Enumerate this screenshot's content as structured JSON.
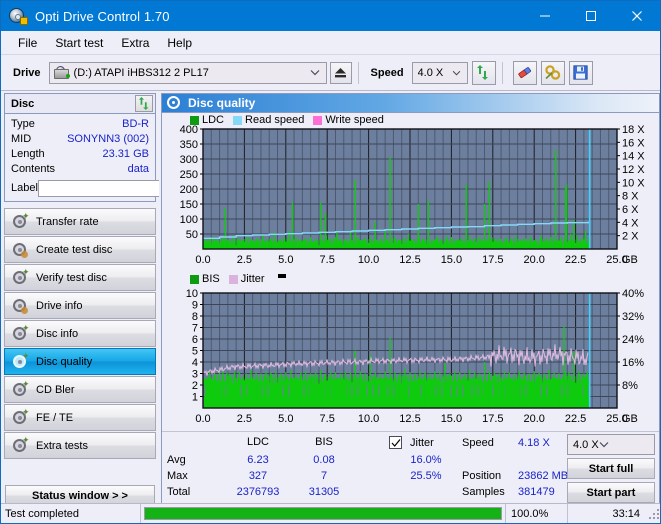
{
  "window": {
    "title": "Opti Drive Control 1.70",
    "icon": "app-disc-icon",
    "minimize": "minimize-icon",
    "maximize": "maximize-icon",
    "close": "close-icon"
  },
  "menubar": {
    "items": [
      {
        "label": "File"
      },
      {
        "label": "Start test"
      },
      {
        "label": "Extra"
      },
      {
        "label": "Help"
      }
    ]
  },
  "toolbar": {
    "drive_label": "Drive",
    "drive_value": "(D:)  ATAPI iHBS312  2 PL17",
    "eject_icon": "eject-icon",
    "speed_label": "Speed",
    "speed_value": "4.0 X",
    "refresh_icon": "refresh-icon",
    "erase_icon": "eraser-icon",
    "tools_icon": "tools-icon",
    "save_icon": "save-icon"
  },
  "sidebar": {
    "disc_panel": {
      "title": "Disc",
      "refresh_icon": "refresh-icon",
      "rows": [
        {
          "key": "Type",
          "value": "BD-R"
        },
        {
          "key": "MID",
          "value": "SONYNN3 (002)"
        },
        {
          "key": "Length",
          "value": "23.31 GB"
        },
        {
          "key": "Contents",
          "value": "data"
        }
      ],
      "label_key": "Label",
      "label_value": "",
      "label_placeholder": "",
      "disc_button_icon": "cd-icon"
    },
    "nav": [
      {
        "label": "Transfer rate",
        "active": false
      },
      {
        "label": "Create test disc",
        "active": false
      },
      {
        "label": "Verify test disc",
        "active": false
      },
      {
        "label": "Drive info",
        "active": false
      },
      {
        "label": "Disc info",
        "active": false
      },
      {
        "label": "Disc quality",
        "active": true
      },
      {
        "label": "CD Bler",
        "active": false
      },
      {
        "label": "FE / TE",
        "active": false
      },
      {
        "label": "Extra tests",
        "active": false
      }
    ],
    "status_window_button": "Status window > >"
  },
  "main": {
    "panel_title": "Disc quality",
    "panel_icon": "disc-quality-icon"
  },
  "stats": {
    "col_headers": [
      "LDC",
      "BIS"
    ],
    "row_headers": [
      "Avg",
      "Max",
      "Total"
    ],
    "ldc": {
      "avg": "6.23",
      "max": "327",
      "total": "2376793"
    },
    "bis": {
      "avg": "0.08",
      "max": "7",
      "total": "31305"
    },
    "jitter": {
      "label": "Jitter",
      "checked": true,
      "avg": "16.0%",
      "max": "25.5%"
    },
    "speed_label": "Speed",
    "speed_value": "4.18 X",
    "position_label": "Position",
    "position_value": "23862 MB",
    "samples_label": "Samples",
    "samples_value": "381479",
    "speed_select": "4.0 X",
    "start_full_button": "Start full",
    "start_part_button": "Start part"
  },
  "statusbar": {
    "text": "Test completed",
    "percent": "100.0%",
    "progress": 100,
    "time": "33:14",
    "progress_color": "#15b215"
  },
  "chart_data": [
    {
      "id": "ldc-chart",
      "type": "line",
      "title": "",
      "xlabel": "GB",
      "ylabel": "",
      "xlim": [
        0,
        25.0
      ],
      "xticks": [
        "0.0",
        "2.5",
        "5.0",
        "7.5",
        "10.0",
        "12.5",
        "15.0",
        "17.5",
        "20.0",
        "22.5",
        "25.0"
      ],
      "ylim": [
        0,
        400
      ],
      "yticks": [
        "50",
        "100",
        "150",
        "200",
        "250",
        "300",
        "350",
        "400"
      ],
      "y2lim": [
        0,
        18
      ],
      "y2ticks": [
        "2 X",
        "4 X",
        "6 X",
        "8 X",
        "10 X",
        "12 X",
        "14 X",
        "16 X",
        "18 X"
      ],
      "grid": true,
      "plot_bg": "#6d7f9e",
      "legend_position": "top-left",
      "legend": [
        {
          "name": "LDC",
          "color": "#0f9b0f"
        },
        {
          "name": "Read speed",
          "color": "#86d8f7"
        },
        {
          "name": "Write speed",
          "color": "#ff6ed4"
        }
      ],
      "series": [
        {
          "name": "LDC",
          "type": "impulse",
          "color": "#0ecb0e",
          "x": [
            0.1,
            0.3,
            0.6,
            0.9,
            1.2,
            1.35,
            1.5,
            1.8,
            2.1,
            2.4,
            2.7,
            3.0,
            3.3,
            3.6,
            3.9,
            4.1,
            4.3,
            4.6,
            4.9,
            5.2,
            5.4,
            5.6,
            5.9,
            6.2,
            6.5,
            6.8,
            7.1,
            7.4,
            7.45,
            7.7,
            8.0,
            8.1,
            8.3,
            8.6,
            8.9,
            9.2,
            9.35,
            9.5,
            9.8,
            10.1,
            10.4,
            10.45,
            10.7,
            11.0,
            11.3,
            11.6,
            11.85,
            12.1,
            12.4,
            12.7,
            13.0,
            13.05,
            13.3,
            13.6,
            13.9,
            14.1,
            14.15,
            14.4,
            14.7,
            15.0,
            15.3,
            15.6,
            15.9,
            16.1,
            16.15,
            16.4,
            16.7,
            17.0,
            17.3,
            17.4,
            17.45,
            17.7,
            18.0,
            18.3,
            18.6,
            18.9,
            19.2,
            19.5,
            19.8,
            20.1,
            20.4,
            20.7,
            21.0,
            21.3,
            21.6,
            21.9,
            21.95,
            22.1,
            22.2,
            22.4,
            22.6,
            22.9,
            23.1,
            23.3
          ],
          "y": [
            35,
            30,
            40,
            25,
            35,
            135,
            30,
            45,
            35,
            30,
            40,
            30,
            35,
            45,
            30,
            35,
            55,
            30,
            40,
            60,
            155,
            40,
            30,
            35,
            40,
            30,
            155,
            120,
            45,
            35,
            40,
            60,
            35,
            30,
            55,
            230,
            40,
            30,
            35,
            40,
            90,
            30,
            35,
            60,
            305,
            40,
            30,
            35,
            50,
            30,
            150,
            40,
            35,
            160,
            30,
            40,
            35,
            30,
            45,
            40,
            30,
            35,
            215,
            45,
            30,
            35,
            40,
            150,
            225,
            30,
            40,
            35,
            30,
            40,
            35,
            45,
            30,
            35,
            40,
            30,
            45,
            35,
            40,
            330,
            40,
            205,
            215,
            30,
            50,
            95,
            45,
            40,
            60,
            30
          ]
        },
        {
          "name": "Read speed",
          "type": "step",
          "color": "#86d8f7",
          "x": [
            0.0,
            1.0,
            2.0,
            3.0,
            4.0,
            5.0,
            6.0,
            7.0,
            8.0,
            9.0,
            10.0,
            11.0,
            12.0,
            13.0,
            14.0,
            15.0,
            16.0,
            17.0,
            18.0,
            19.0,
            20.0,
            21.0,
            22.0,
            23.3,
            23.35
          ],
          "y": [
            1.6,
            1.8,
            2.0,
            2.1,
            2.2,
            2.3,
            2.4,
            2.5,
            2.6,
            2.7,
            2.8,
            2.9,
            3.0,
            3.1,
            3.2,
            3.3,
            3.35,
            3.5,
            3.6,
            3.7,
            3.8,
            3.9,
            3.95,
            4.0,
            18.0
          ]
        }
      ],
      "cursor_x": 23.35,
      "cursor_color": "#3fd2ff"
    },
    {
      "id": "bis-jitter-chart",
      "type": "line",
      "title": "",
      "xlabel": "GB",
      "ylabel": "",
      "xlim": [
        0,
        25.0
      ],
      "xticks": [
        "0.0",
        "2.5",
        "5.0",
        "7.5",
        "10.0",
        "12.5",
        "15.0",
        "17.5",
        "20.0",
        "22.5",
        "25.0"
      ],
      "ylim": [
        0,
        10
      ],
      "yticks": [
        "1",
        "2",
        "3",
        "4",
        "5",
        "6",
        "7",
        "8",
        "9",
        "10"
      ],
      "y2lim": [
        0,
        40
      ],
      "y2ticks": [
        "8%",
        "16%",
        "24%",
        "32%",
        "40%"
      ],
      "grid": true,
      "plot_bg": "#6d7f9e",
      "legend_position": "top-left",
      "legend": [
        {
          "name": "BIS",
          "color": "#0f9b0f"
        },
        {
          "name": "Jitter",
          "color": "#d9b3dd"
        }
      ],
      "series": [
        {
          "name": "BIS",
          "type": "impulse-filled",
          "color": "#0ecb0e",
          "baseline": 2,
          "spikes_x": [
            0.4,
            0.7,
            1.0,
            1.2,
            1.45,
            1.6,
            1.9,
            2.2,
            2.6,
            2.9,
            3.2,
            3.5,
            3.8,
            4.1,
            4.4,
            4.7,
            5.0,
            5.3,
            5.6,
            5.9,
            6.2,
            6.5,
            6.8,
            7.1,
            7.4,
            7.7,
            8.0,
            8.3,
            8.6,
            8.9,
            9.2,
            9.5,
            9.8,
            10.1,
            10.4,
            10.7,
            11.0,
            11.3,
            11.6,
            11.9,
            12.2,
            12.5,
            12.8,
            13.1,
            13.4,
            13.7,
            14.0,
            14.3,
            14.6,
            14.9,
            15.2,
            15.5,
            15.8,
            16.1,
            16.4,
            16.7,
            17.0,
            17.3,
            17.6,
            17.9,
            18.2,
            18.5,
            18.8,
            19.1,
            19.4,
            19.7,
            20.0,
            20.3,
            20.6,
            20.9,
            21.2,
            21.5,
            21.8,
            21.9,
            22.1,
            22.4,
            22.7,
            23.0,
            23.2
          ],
          "spikes_y": [
            3.1,
            3.0,
            3.3,
            3.2,
            3.1,
            3.0,
            3.2,
            3.1,
            3.0,
            3.3,
            3.1,
            3.0,
            3.2,
            3.1,
            3.2,
            3.0,
            3.1,
            3.3,
            3.0,
            3.1,
            3.2,
            3.0,
            3.1,
            3.3,
            3.0,
            3.2,
            3.1,
            3.0,
            3.2,
            3.1,
            5.0,
            3.2,
            3.0,
            4.6,
            3.1,
            3.0,
            3.2,
            6.1,
            3.1,
            3.0,
            3.4,
            3.1,
            3.0,
            3.2,
            3.1,
            3.0,
            3.2,
            3.1,
            3.9,
            3.0,
            3.2,
            3.1,
            3.0,
            3.3,
            3.1,
            3.0,
            4.0,
            3.2,
            3.1,
            3.0,
            3.2,
            3.1,
            3.0,
            3.2,
            3.1,
            3.0,
            3.2,
            3.1,
            3.0,
            3.3,
            3.1,
            3.0,
            7.1,
            3.2,
            3.1,
            4.9,
            3.2,
            3.0,
            3.1
          ]
        },
        {
          "name": "Jitter",
          "type": "line-noisy",
          "color": "#e0badf",
          "x": [
            0.0,
            0.5,
            1.0,
            1.5,
            2.0,
            2.5,
            3.0,
            3.5,
            4.0,
            4.5,
            5.0,
            5.5,
            6.0,
            6.5,
            7.0,
            7.5,
            8.0,
            8.5,
            9.0,
            9.5,
            10.0,
            10.5,
            11.0,
            11.5,
            12.0,
            12.5,
            13.0,
            13.5,
            14.0,
            14.5,
            15.0,
            15.5,
            16.0,
            16.5,
            17.0,
            17.5,
            18.0,
            18.5,
            19.0,
            19.5,
            20.0,
            20.5,
            21.0,
            21.5,
            22.0,
            22.5,
            23.0,
            23.3
          ],
          "y": [
            3.0,
            3.2,
            3.3,
            3.5,
            3.6,
            3.6,
            3.65,
            3.7,
            3.7,
            3.75,
            3.8,
            3.85,
            3.85,
            3.9,
            3.9,
            3.95,
            3.95,
            4.0,
            4.0,
            4.0,
            4.05,
            4.1,
            4.1,
            4.1,
            4.15,
            4.15,
            4.15,
            4.2,
            4.2,
            4.2,
            4.2,
            4.25,
            4.3,
            4.35,
            4.4,
            4.5,
            4.6,
            4.6,
            4.6,
            4.4,
            4.4,
            4.5,
            4.6,
            4.7,
            4.5,
            4.4,
            4.3,
            4.25
          ]
        }
      ],
      "cursor_x": 23.35,
      "cursor_color": "#3fd2ff"
    }
  ]
}
